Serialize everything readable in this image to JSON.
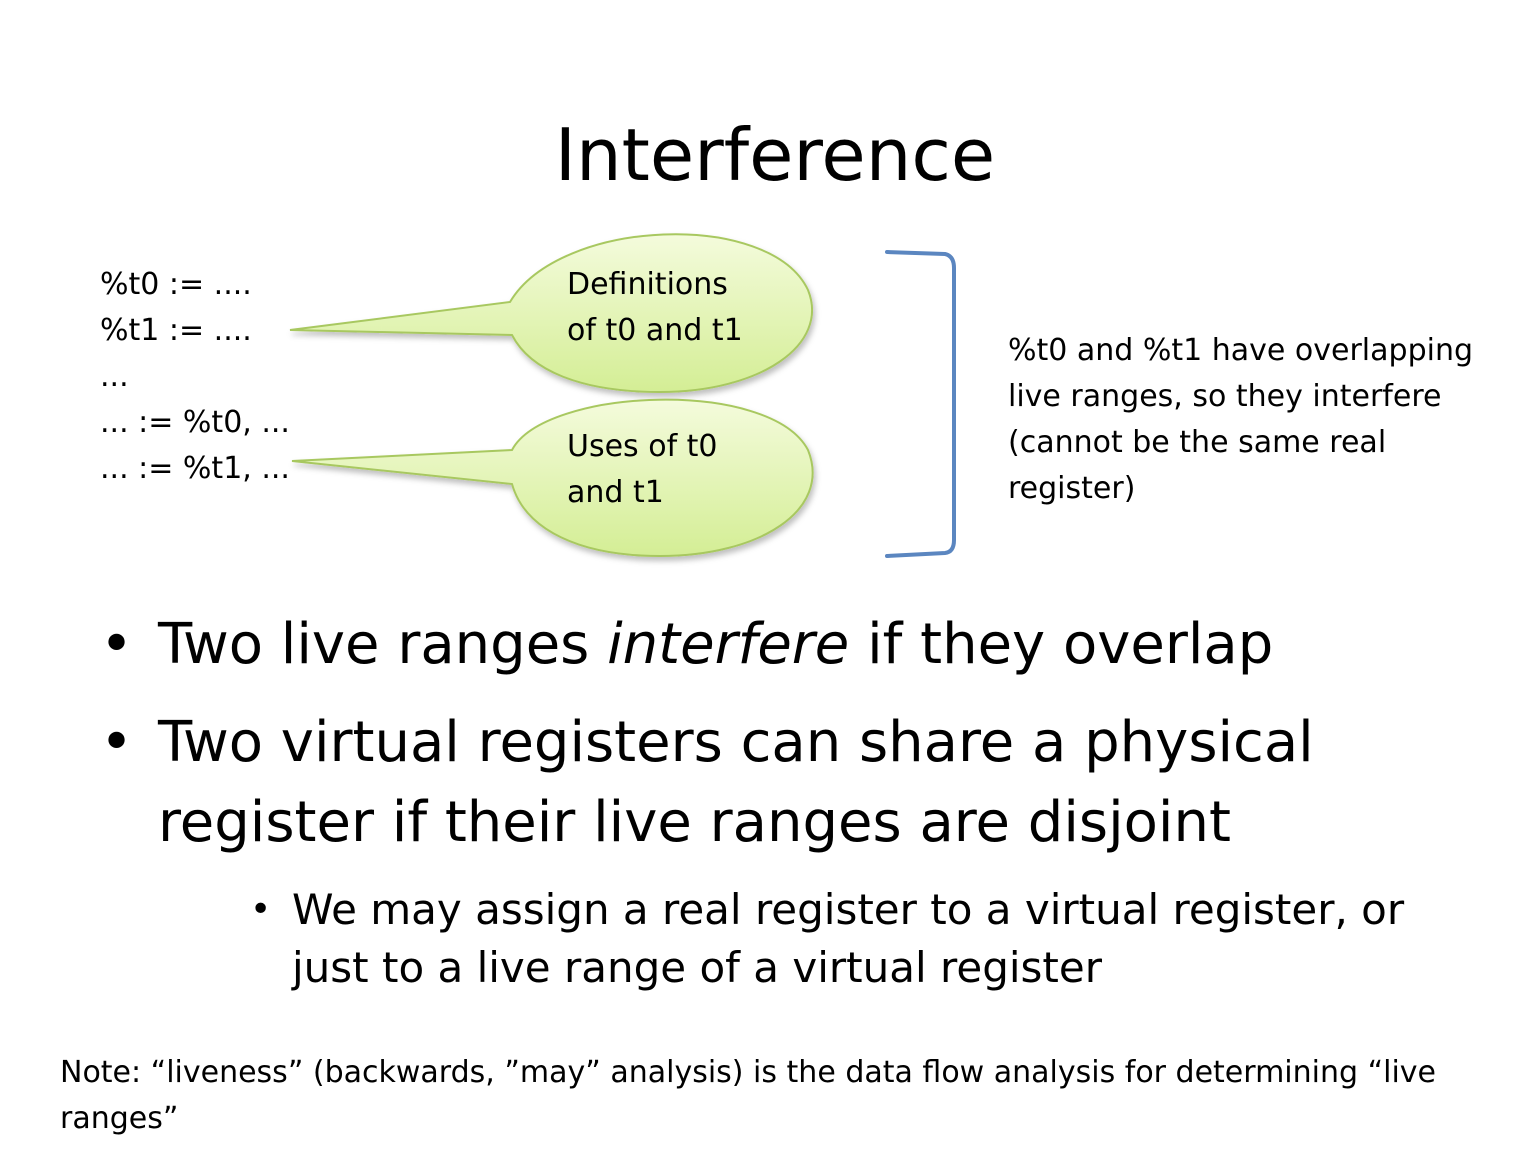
{
  "title": "Interference",
  "code_lines": [
    "%t0 := ....",
    "%t1 := ....",
    "...",
    "... := %t0, ...",
    "... := %t1, ..."
  ],
  "callouts": {
    "definitions": [
      "Definitions",
      "of t0 and t1"
    ],
    "uses": [
      "Uses of t0",
      "and t1"
    ]
  },
  "side_note": "%t0 and %t1 have overlapping live ranges, so they interfere (cannot be the same real register)",
  "bullets": {
    "b1_before": "Two live ranges ",
    "b1_em": "interfere",
    "b1_after": " if they overlap",
    "b2": "Two virtual registers can share a physical register if their live ranges are disjoint",
    "sub": "We may assign a real register to a virtual register, or just to a live range of a virtual register",
    "bullet_char": "•"
  },
  "footer_note": "Note: “liveness” (backwards, ”may” analysis) is the data flow analysis for determining “live ranges”",
  "colors": {
    "callout_fill_top": "#f4fbdc",
    "callout_fill_bottom": "#d4ee95",
    "callout_stroke": "#a8c860",
    "bracket": "#5b86c0"
  }
}
